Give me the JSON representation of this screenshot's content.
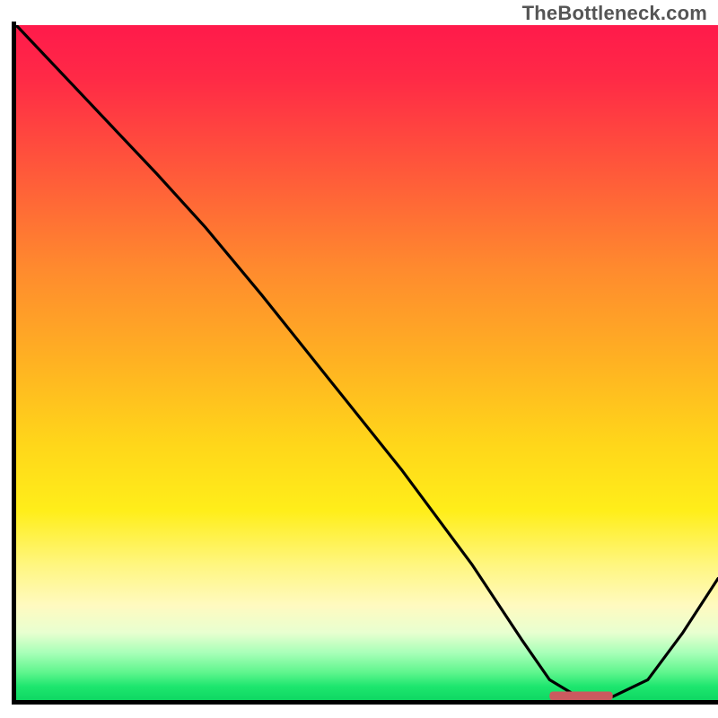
{
  "watermark": "TheBottleneck.com",
  "chart_data": {
    "type": "line",
    "title": "",
    "xlabel": "",
    "ylabel": "",
    "xlim": [
      0,
      100
    ],
    "ylim": [
      0,
      100
    ],
    "grid": false,
    "legend": false,
    "series": [
      {
        "name": "curve",
        "x": [
          0,
          10,
          20,
          27,
          35,
          45,
          55,
          65,
          72,
          76,
          80,
          85,
          90,
          95,
          100
        ],
        "y": [
          100,
          89,
          78,
          70,
          60,
          47,
          34,
          20,
          9,
          3,
          0.5,
          0.5,
          3,
          10,
          18
        ]
      }
    ],
    "marker": {
      "name": "highlight-bar",
      "x_start": 76,
      "x_end": 85,
      "y": 0.6,
      "color": "#cb5a5f"
    },
    "gradient_stops": [
      {
        "pos": 0.0,
        "color": "#ff1a4b"
      },
      {
        "pos": 0.5,
        "color": "#ffd61a"
      },
      {
        "pos": 0.86,
        "color": "#fffac0"
      },
      {
        "pos": 1.0,
        "color": "#0fd863"
      }
    ]
  }
}
